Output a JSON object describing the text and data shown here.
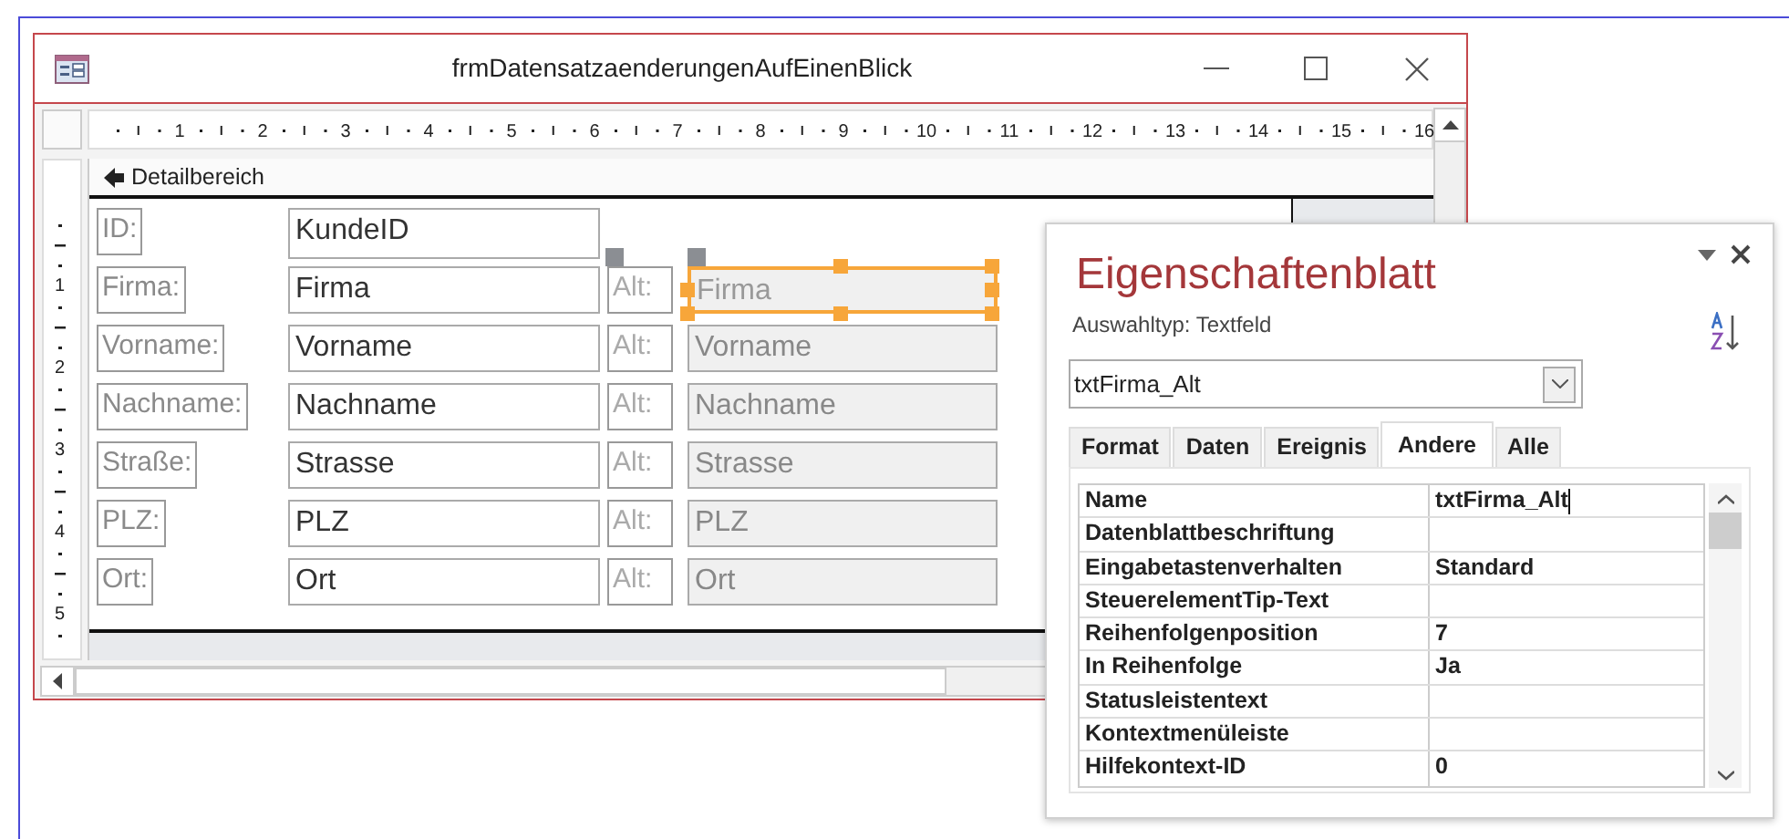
{
  "window": {
    "title": "frmDatensatzaenderungenAufEinenBlick"
  },
  "ruler": {
    "horizontal": [
      "1",
      "2",
      "3",
      "4",
      "5",
      "6",
      "7",
      "8",
      "9",
      "10",
      "11",
      "12",
      "13",
      "14",
      "15",
      "16"
    ],
    "vertical": [
      "1",
      "2",
      "3",
      "4",
      "5"
    ]
  },
  "section": {
    "title": "Detailbereich"
  },
  "rows": [
    {
      "label": "ID:",
      "field": "KundeID"
    },
    {
      "label": "Firma:",
      "field": "Firma",
      "alt_label": "Alt:",
      "alt_field": "Firma",
      "selected": true
    },
    {
      "label": "Vorname:",
      "field": "Vorname",
      "alt_label": "Alt:",
      "alt_field": "Vorname",
      "selected": false
    },
    {
      "label": "Nachname:",
      "field": "Nachname",
      "alt_label": "Alt:",
      "alt_field": "Nachname",
      "selected": false
    },
    {
      "label": "Straße:",
      "field": "Strasse",
      "alt_label": "Alt:",
      "alt_field": "Strasse",
      "selected": false
    },
    {
      "label": "PLZ:",
      "field": "PLZ",
      "alt_label": "Alt:",
      "alt_field": "PLZ",
      "selected": false
    },
    {
      "label": "Ort:",
      "field": "Ort",
      "alt_label": "Alt:",
      "alt_field": "Ort",
      "selected": false
    }
  ],
  "property_sheet": {
    "title": "Eigenschaftenblatt",
    "selection_type_label": "Auswahltyp:",
    "selection_type": "Textfeld",
    "object": "txtFirma_Alt",
    "tabs": [
      {
        "label": "Format",
        "selected": false
      },
      {
        "label": "Daten",
        "selected": false
      },
      {
        "label": "Ereignis",
        "selected": false
      },
      {
        "label": "Andere",
        "selected": true
      },
      {
        "label": "Alle",
        "selected": false
      }
    ],
    "properties": [
      {
        "name": "Name",
        "value": "txtFirma_Alt",
        "editing": true
      },
      {
        "name": "Datenblattbeschriftung",
        "editing": false
      },
      {
        "name": "Eingabetastenverhalten",
        "value": "Standard",
        "editing": false
      },
      {
        "name": "SteuerelementTip-Text",
        "editing": false
      },
      {
        "name": "Reihenfolgenposition",
        "value": "7",
        "editing": false
      },
      {
        "name": "In Reihenfolge",
        "value": "Ja",
        "editing": false
      },
      {
        "name": "Statusleistentext",
        "editing": false
      },
      {
        "name": "Kontextmenüleiste",
        "editing": false
      },
      {
        "name": "Hilfekontext-ID",
        "value": "0",
        "editing": false
      }
    ]
  }
}
